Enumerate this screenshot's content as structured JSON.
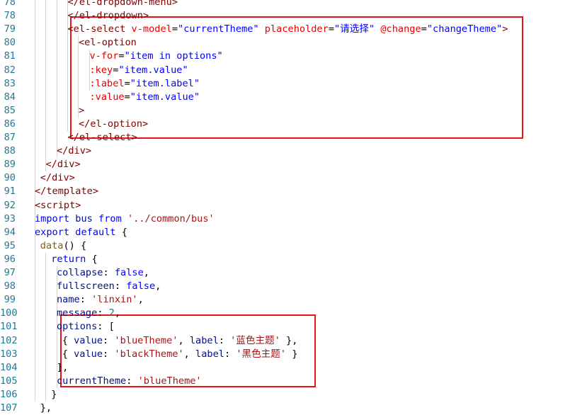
{
  "editor": {
    "lines": [
      {
        "n": "78",
        "indent": 3,
        "tokens": [
          {
            "t": "</el-dropdown-menu>",
            "c": "tag"
          }
        ]
      },
      {
        "n": "78",
        "indent": 3,
        "tokens": [
          {
            "t": "</el-dropdown>",
            "c": "tag"
          }
        ]
      },
      {
        "n": "79",
        "indent": 3,
        "tokens": [
          {
            "t": "<el-select ",
            "c": "tag"
          },
          {
            "t": "v-model",
            "c": "attr"
          },
          {
            "t": "=",
            "c": "plain"
          },
          {
            "t": "\"currentTheme\"",
            "c": "str"
          },
          {
            "t": " placeholder",
            "c": "attr"
          },
          {
            "t": "=",
            "c": "plain"
          },
          {
            "t": "\"请选择\"",
            "c": "str"
          },
          {
            "t": " @change",
            "c": "attr"
          },
          {
            "t": "=",
            "c": "plain"
          },
          {
            "t": "\"changeTheme\"",
            "c": "str"
          },
          {
            "t": ">",
            "c": "tag"
          }
        ]
      },
      {
        "n": "80",
        "indent": 4,
        "tokens": [
          {
            "t": "<el-option",
            "c": "tag"
          }
        ]
      },
      {
        "n": "81",
        "indent": 5,
        "tokens": [
          {
            "t": "v-for",
            "c": "attr"
          },
          {
            "t": "=",
            "c": "plain"
          },
          {
            "t": "\"item in options\"",
            "c": "str"
          }
        ]
      },
      {
        "n": "82",
        "indent": 5,
        "tokens": [
          {
            "t": ":key",
            "c": "attr"
          },
          {
            "t": "=",
            "c": "plain"
          },
          {
            "t": "\"item.value\"",
            "c": "str"
          }
        ]
      },
      {
        "n": "83",
        "indent": 5,
        "tokens": [
          {
            "t": ":label",
            "c": "attr"
          },
          {
            "t": "=",
            "c": "plain"
          },
          {
            "t": "\"item.label\"",
            "c": "str"
          }
        ]
      },
      {
        "n": "84",
        "indent": 5,
        "tokens": [
          {
            "t": ":value",
            "c": "attr"
          },
          {
            "t": "=",
            "c": "plain"
          },
          {
            "t": "\"item.value\"",
            "c": "str"
          }
        ]
      },
      {
        "n": "85",
        "indent": 4,
        "tokens": [
          {
            "t": ">",
            "c": "tag"
          }
        ]
      },
      {
        "n": "86",
        "indent": 4,
        "tokens": [
          {
            "t": "</el-option>",
            "c": "tag"
          }
        ]
      },
      {
        "n": "87",
        "indent": 3,
        "tokens": [
          {
            "t": "</el-select>",
            "c": "tag"
          }
        ]
      },
      {
        "n": "88",
        "indent": 2,
        "tokens": [
          {
            "t": "</div>",
            "c": "tag"
          }
        ]
      },
      {
        "n": "89",
        "indent": 1,
        "tokens": [
          {
            "t": "</div>",
            "c": "tag"
          }
        ]
      },
      {
        "n": "90",
        "indent": 0.5,
        "tokens": [
          {
            "t": "</div>",
            "c": "tag"
          }
        ]
      },
      {
        "n": "91",
        "indent": 0,
        "tokens": [
          {
            "t": "</template>",
            "c": "tag"
          }
        ]
      },
      {
        "n": "92",
        "indent": 0,
        "tokens": [
          {
            "t": "<script>",
            "c": "tag"
          }
        ]
      },
      {
        "n": "93",
        "indent": 0,
        "tokens": [
          {
            "t": "import",
            "c": "kw"
          },
          {
            "t": " bus ",
            "c": "prop"
          },
          {
            "t": "from",
            "c": "kw"
          },
          {
            "t": " '../common/bus'",
            "c": "strg"
          }
        ]
      },
      {
        "n": "94",
        "indent": 0,
        "tokens": [
          {
            "t": "export",
            "c": "kw"
          },
          {
            "t": " ",
            "c": "plain"
          },
          {
            "t": "default",
            "c": "kw"
          },
          {
            "t": " {",
            "c": "plain"
          }
        ]
      },
      {
        "n": "95",
        "indent": 0.5,
        "tokens": [
          {
            "t": "data",
            "c": "func"
          },
          {
            "t": "() {",
            "c": "plain"
          }
        ]
      },
      {
        "n": "96",
        "indent": 1.5,
        "tokens": [
          {
            "t": "return",
            "c": "kw"
          },
          {
            "t": " {",
            "c": "plain"
          }
        ]
      },
      {
        "n": "97",
        "indent": 2,
        "tokens": [
          {
            "t": "collapse",
            "c": "prop"
          },
          {
            "t": ": ",
            "c": "plain"
          },
          {
            "t": "false",
            "c": "kw"
          },
          {
            "t": ",",
            "c": "plain"
          }
        ]
      },
      {
        "n": "98",
        "indent": 2,
        "tokens": [
          {
            "t": "fullscreen",
            "c": "prop"
          },
          {
            "t": ": ",
            "c": "plain"
          },
          {
            "t": "false",
            "c": "kw"
          },
          {
            "t": ",",
            "c": "plain"
          }
        ]
      },
      {
        "n": "99",
        "indent": 2,
        "tokens": [
          {
            "t": "name",
            "c": "prop"
          },
          {
            "t": ": ",
            "c": "plain"
          },
          {
            "t": "'linxin'",
            "c": "strg"
          },
          {
            "t": ",",
            "c": "plain"
          }
        ]
      },
      {
        "n": "100",
        "indent": 2,
        "tokens": [
          {
            "t": "message",
            "c": "prop"
          },
          {
            "t": ": ",
            "c": "plain"
          },
          {
            "t": "2",
            "c": "num"
          },
          {
            "t": ",",
            "c": "plain"
          }
        ]
      },
      {
        "n": "101",
        "indent": 2,
        "tokens": [
          {
            "t": "options",
            "c": "prop"
          },
          {
            "t": ": [",
            "c": "plain"
          }
        ]
      },
      {
        "n": "102",
        "indent": 2.5,
        "tokens": [
          {
            "t": "{ ",
            "c": "plain"
          },
          {
            "t": "value",
            "c": "prop"
          },
          {
            "t": ": ",
            "c": "plain"
          },
          {
            "t": "'blueTheme'",
            "c": "strg"
          },
          {
            "t": ", ",
            "c": "plain"
          },
          {
            "t": "label",
            "c": "prop"
          },
          {
            "t": ": ",
            "c": "plain"
          },
          {
            "t": "'蓝色主题'",
            "c": "strg"
          },
          {
            "t": " },",
            "c": "plain"
          }
        ]
      },
      {
        "n": "103",
        "indent": 2.5,
        "tokens": [
          {
            "t": "{ ",
            "c": "plain"
          },
          {
            "t": "value",
            "c": "prop"
          },
          {
            "t": ": ",
            "c": "plain"
          },
          {
            "t": "'blackTheme'",
            "c": "strg"
          },
          {
            "t": ", ",
            "c": "plain"
          },
          {
            "t": "label",
            "c": "prop"
          },
          {
            "t": ": ",
            "c": "plain"
          },
          {
            "t": "'黑色主题'",
            "c": "strg"
          },
          {
            "t": " }",
            "c": "plain"
          }
        ]
      },
      {
        "n": "104",
        "indent": 2,
        "tokens": [
          {
            "t": "],",
            "c": "plain"
          }
        ]
      },
      {
        "n": "105",
        "indent": 2,
        "tokens": [
          {
            "t": "currentTheme",
            "c": "prop"
          },
          {
            "t": ": ",
            "c": "plain"
          },
          {
            "t": "'blueTheme'",
            "c": "strg"
          }
        ]
      },
      {
        "n": "106",
        "indent": 1.5,
        "tokens": [
          {
            "t": "}",
            "c": "plain"
          }
        ]
      },
      {
        "n": "107",
        "indent": 0.5,
        "tokens": [
          {
            "t": "},",
            "c": "plain"
          }
        ]
      }
    ]
  },
  "highlight_color": "#e8141c"
}
